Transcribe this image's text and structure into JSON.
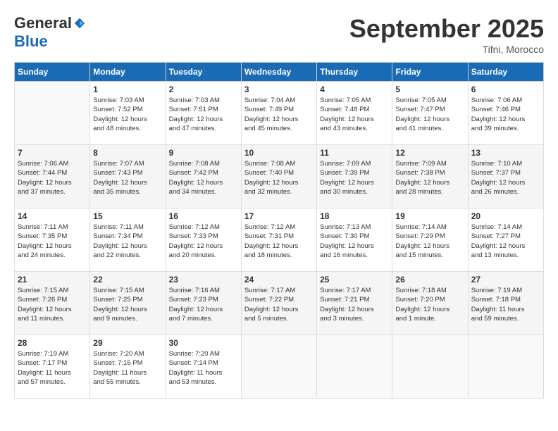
{
  "header": {
    "logo_general": "General",
    "logo_blue": "Blue",
    "month": "September 2025",
    "location": "Tifni, Morocco"
  },
  "days_of_week": [
    "Sunday",
    "Monday",
    "Tuesday",
    "Wednesday",
    "Thursday",
    "Friday",
    "Saturday"
  ],
  "weeks": [
    [
      {
        "day": "",
        "info": ""
      },
      {
        "day": "1",
        "info": "Sunrise: 7:03 AM\nSunset: 7:52 PM\nDaylight: 12 hours\nand 48 minutes."
      },
      {
        "day": "2",
        "info": "Sunrise: 7:03 AM\nSunset: 7:51 PM\nDaylight: 12 hours\nand 47 minutes."
      },
      {
        "day": "3",
        "info": "Sunrise: 7:04 AM\nSunset: 7:49 PM\nDaylight: 12 hours\nand 45 minutes."
      },
      {
        "day": "4",
        "info": "Sunrise: 7:05 AM\nSunset: 7:48 PM\nDaylight: 12 hours\nand 43 minutes."
      },
      {
        "day": "5",
        "info": "Sunrise: 7:05 AM\nSunset: 7:47 PM\nDaylight: 12 hours\nand 41 minutes."
      },
      {
        "day": "6",
        "info": "Sunrise: 7:06 AM\nSunset: 7:46 PM\nDaylight: 12 hours\nand 39 minutes."
      }
    ],
    [
      {
        "day": "7",
        "info": "Sunrise: 7:06 AM\nSunset: 7:44 PM\nDaylight: 12 hours\nand 37 minutes."
      },
      {
        "day": "8",
        "info": "Sunrise: 7:07 AM\nSunset: 7:43 PM\nDaylight: 12 hours\nand 35 minutes."
      },
      {
        "day": "9",
        "info": "Sunrise: 7:08 AM\nSunset: 7:42 PM\nDaylight: 12 hours\nand 34 minutes."
      },
      {
        "day": "10",
        "info": "Sunrise: 7:08 AM\nSunset: 7:40 PM\nDaylight: 12 hours\nand 32 minutes."
      },
      {
        "day": "11",
        "info": "Sunrise: 7:09 AM\nSunset: 7:39 PM\nDaylight: 12 hours\nand 30 minutes."
      },
      {
        "day": "12",
        "info": "Sunrise: 7:09 AM\nSunset: 7:38 PM\nDaylight: 12 hours\nand 28 minutes."
      },
      {
        "day": "13",
        "info": "Sunrise: 7:10 AM\nSunset: 7:37 PM\nDaylight: 12 hours\nand 26 minutes."
      }
    ],
    [
      {
        "day": "14",
        "info": "Sunrise: 7:11 AM\nSunset: 7:35 PM\nDaylight: 12 hours\nand 24 minutes."
      },
      {
        "day": "15",
        "info": "Sunrise: 7:11 AM\nSunset: 7:34 PM\nDaylight: 12 hours\nand 22 minutes."
      },
      {
        "day": "16",
        "info": "Sunrise: 7:12 AM\nSunset: 7:33 PM\nDaylight: 12 hours\nand 20 minutes."
      },
      {
        "day": "17",
        "info": "Sunrise: 7:12 AM\nSunset: 7:31 PM\nDaylight: 12 hours\nand 18 minutes."
      },
      {
        "day": "18",
        "info": "Sunrise: 7:13 AM\nSunset: 7:30 PM\nDaylight: 12 hours\nand 16 minutes."
      },
      {
        "day": "19",
        "info": "Sunrise: 7:14 AM\nSunset: 7:29 PM\nDaylight: 12 hours\nand 15 minutes."
      },
      {
        "day": "20",
        "info": "Sunrise: 7:14 AM\nSunset: 7:27 PM\nDaylight: 12 hours\nand 13 minutes."
      }
    ],
    [
      {
        "day": "21",
        "info": "Sunrise: 7:15 AM\nSunset: 7:26 PM\nDaylight: 12 hours\nand 11 minutes."
      },
      {
        "day": "22",
        "info": "Sunrise: 7:15 AM\nSunset: 7:25 PM\nDaylight: 12 hours\nand 9 minutes."
      },
      {
        "day": "23",
        "info": "Sunrise: 7:16 AM\nSunset: 7:23 PM\nDaylight: 12 hours\nand 7 minutes."
      },
      {
        "day": "24",
        "info": "Sunrise: 7:17 AM\nSunset: 7:22 PM\nDaylight: 12 hours\nand 5 minutes."
      },
      {
        "day": "25",
        "info": "Sunrise: 7:17 AM\nSunset: 7:21 PM\nDaylight: 12 hours\nand 3 minutes."
      },
      {
        "day": "26",
        "info": "Sunrise: 7:18 AM\nSunset: 7:20 PM\nDaylight: 12 hours\nand 1 minute."
      },
      {
        "day": "27",
        "info": "Sunrise: 7:19 AM\nSunset: 7:18 PM\nDaylight: 11 hours\nand 59 minutes."
      }
    ],
    [
      {
        "day": "28",
        "info": "Sunrise: 7:19 AM\nSunset: 7:17 PM\nDaylight: 11 hours\nand 57 minutes."
      },
      {
        "day": "29",
        "info": "Sunrise: 7:20 AM\nSunset: 7:16 PM\nDaylight: 11 hours\nand 55 minutes."
      },
      {
        "day": "30",
        "info": "Sunrise: 7:20 AM\nSunset: 7:14 PM\nDaylight: 11 hours\nand 53 minutes."
      },
      {
        "day": "",
        "info": ""
      },
      {
        "day": "",
        "info": ""
      },
      {
        "day": "",
        "info": ""
      },
      {
        "day": "",
        "info": ""
      }
    ]
  ]
}
